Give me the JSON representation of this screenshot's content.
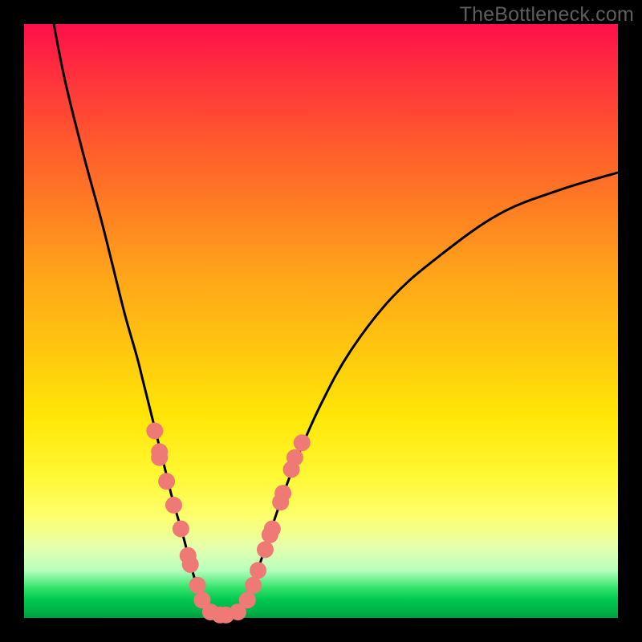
{
  "watermark": "TheBottleneck.com",
  "chart_data": {
    "type": "line",
    "title": "",
    "xlabel": "",
    "ylabel": "",
    "xlim": [
      0,
      100
    ],
    "ylim": [
      0,
      100
    ],
    "grid": false,
    "legend": false,
    "series": [
      {
        "name": "left-curve",
        "x": [
          5,
          7,
          10,
          13,
          15,
          17,
          19,
          20,
          22,
          24,
          25,
          27,
          28,
          30,
          31,
          33,
          34
        ],
        "y": [
          100,
          90,
          78,
          67,
          59,
          51,
          44,
          40,
          32,
          24,
          20,
          13,
          9,
          3,
          1.5,
          0.5,
          0.5
        ],
        "color": "#000000"
      },
      {
        "name": "right-curve",
        "x": [
          34,
          36,
          38,
          39,
          41,
          43,
          46,
          50,
          55,
          62,
          70,
          80,
          90,
          100
        ],
        "y": [
          0.5,
          1,
          4,
          7,
          13,
          19,
          27,
          36,
          45,
          54,
          61,
          68,
          72,
          75
        ],
        "color": "#000000"
      },
      {
        "name": "left-markers",
        "type": "scatter",
        "x": [
          22.0,
          22.8,
          22.8,
          24.0,
          25.2,
          26.4,
          27.6,
          28.0,
          29.2,
          30.0,
          31.4,
          33.0,
          34.0
        ],
        "y": [
          31.5,
          28.0,
          27.0,
          23.0,
          19.0,
          15.0,
          10.5,
          9.0,
          5.5,
          3.0,
          1.0,
          0.5,
          0.5
        ],
        "color": "#ef7a75"
      },
      {
        "name": "right-markers",
        "type": "scatter",
        "x": [
          36.0,
          37.6,
          38.6,
          39.4,
          40.6,
          41.4,
          41.8,
          43.2,
          43.6,
          45.0,
          45.6,
          46.8
        ],
        "y": [
          1.0,
          3.0,
          5.5,
          8.0,
          11.5,
          14.0,
          15.0,
          19.5,
          21.0,
          25.0,
          27.0,
          29.5
        ],
        "color": "#ef7a75"
      }
    ]
  }
}
